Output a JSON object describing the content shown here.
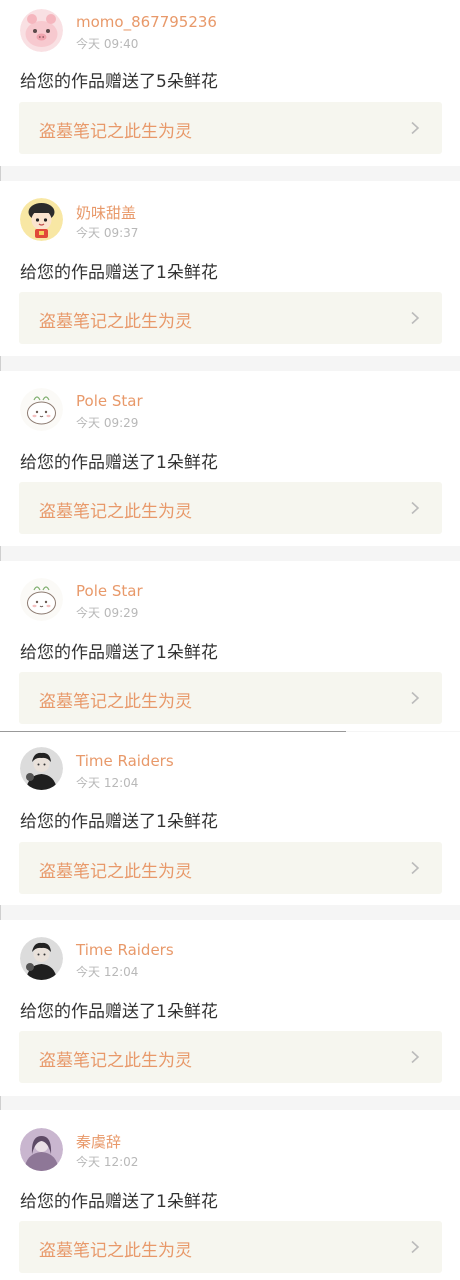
{
  "colors": {
    "accent": "#e8996a",
    "timestamp": "#b8b8b8",
    "message": "#333333",
    "link_bg": "#f6f6ef",
    "page_bg": "#f5f5f5"
  },
  "notifications": [
    {
      "username": "momo_867795236",
      "time": "今天 09:40",
      "message": "给您的作品赠送了5朵鲜花",
      "work_title": "盗墓笔记之此生为灵",
      "avatar_icon": "pink-piglet-avatar-icon"
    },
    {
      "username": "奶味甜盖",
      "time": "今天 09:37",
      "message": "给您的作品赠送了1朵鲜花",
      "work_title": "盗墓笔记之此生为灵",
      "avatar_icon": "cartoon-girl-avatar-icon"
    },
    {
      "username": "Pole Star",
      "time": "今天 09:29",
      "message": "给您的作品赠送了1朵鲜花",
      "work_title": "盗墓笔记之此生为灵",
      "avatar_icon": "sketch-bun-avatar-icon"
    },
    {
      "username": "Pole Star",
      "time": "今天 09:29",
      "message": "给您的作品赠送了1朵鲜花",
      "work_title": "盗墓笔记之此生为灵",
      "avatar_icon": "sketch-bun-avatar-icon"
    },
    {
      "username": "Time Raiders",
      "time": "今天 12:04",
      "message": "给您的作品赠送了1朵鲜花",
      "work_title": "盗墓笔记之此生为灵",
      "avatar_icon": "dark-portrait-avatar-icon"
    },
    {
      "username": "Time Raiders",
      "time": "今天 12:04",
      "message": "给您的作品赠送了1朵鲜花",
      "work_title": "盗墓笔记之此生为灵",
      "avatar_icon": "dark-portrait-avatar-icon"
    },
    {
      "username": "秦虞辞",
      "time": "今天 12:02",
      "message": "给您的作品赠送了1朵鲜花",
      "work_title": "盗墓笔记之此生为灵",
      "avatar_icon": "purple-portrait-avatar-icon"
    }
  ]
}
